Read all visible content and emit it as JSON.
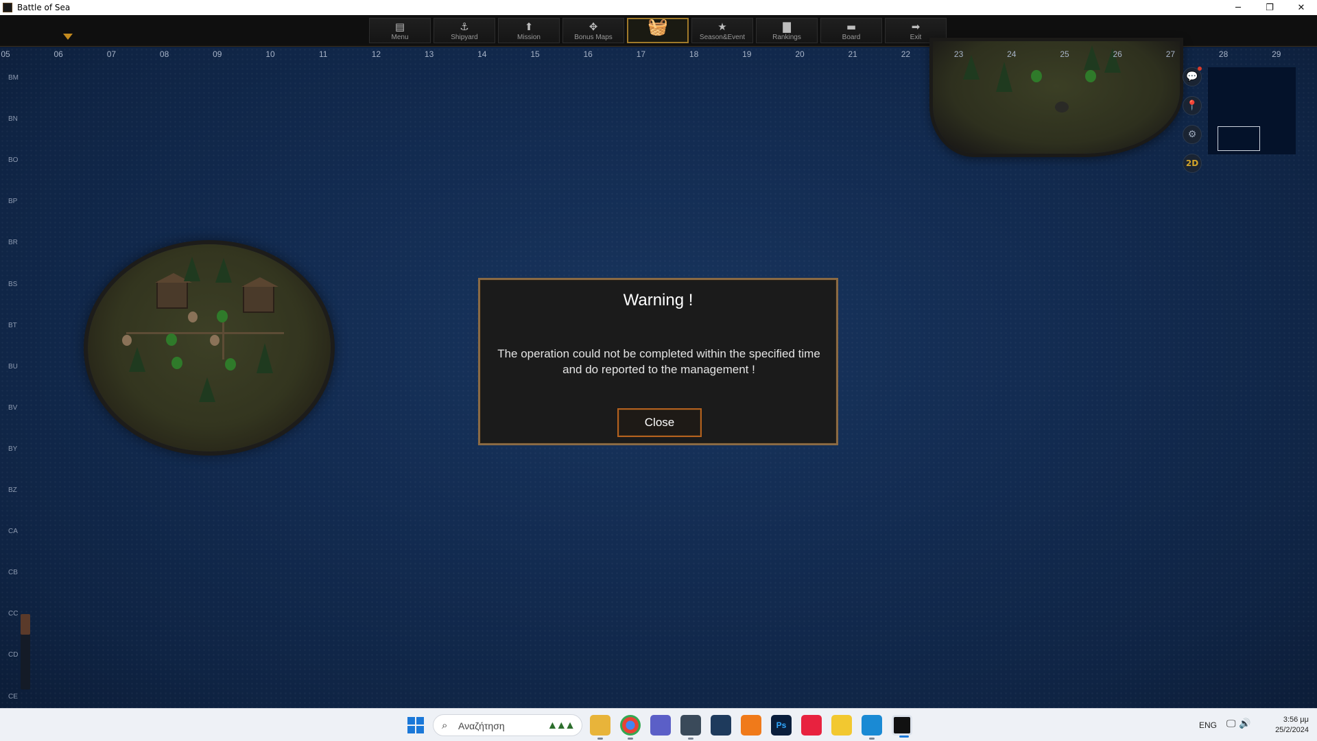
{
  "window": {
    "title": "Battle of Sea",
    "controls": {
      "minimize": "─",
      "restore": "❐",
      "close": "✕"
    }
  },
  "nav": {
    "items": [
      {
        "label": "Menu",
        "icon": "menu-icon",
        "glyph": "▤"
      },
      {
        "label": "Shipyard",
        "icon": "anchor-icon",
        "glyph": "⚓"
      },
      {
        "label": "Mission",
        "icon": "up-arrow-icon",
        "glyph": "⬆"
      },
      {
        "label": "Bonus Maps",
        "icon": "map-compass-icon",
        "glyph": "✥"
      },
      {
        "label": "",
        "icon": "shop-basket-icon",
        "glyph": "🧺"
      },
      {
        "label": "Season&Event",
        "icon": "star-icon",
        "glyph": "★"
      },
      {
        "label": "Rankings",
        "icon": "bar-chart-icon",
        "glyph": "▇"
      },
      {
        "label": "Board",
        "icon": "board-icon",
        "glyph": "▬"
      },
      {
        "label": "Exit",
        "icon": "exit-arrow-icon",
        "glyph": "➡"
      }
    ]
  },
  "grid": {
    "columns": [
      "05",
      "06",
      "07",
      "08",
      "09",
      "10",
      "11",
      "12",
      "13",
      "14",
      "15",
      "16",
      "17",
      "18",
      "19",
      "20",
      "21",
      "22",
      "23",
      "24",
      "25",
      "26",
      "27",
      "28",
      "29"
    ],
    "rows": [
      "BM",
      "BN",
      "BO",
      "BP",
      "BR",
      "BS",
      "BT",
      "BU",
      "BV",
      "BY",
      "BZ",
      "CA",
      "CB",
      "CC",
      "CD",
      "CE"
    ]
  },
  "side_controls": {
    "chat": "💬",
    "location": "📍",
    "settings": "⚙",
    "view_mode": "2D"
  },
  "dialog": {
    "title": "Warning !",
    "message": "The operation could not be completed within the specified time and do reported to the management !",
    "button": "Close"
  },
  "taskbar": {
    "search_placeholder": "Αναζήτηση",
    "language": "ENG",
    "time": "3:56 μμ",
    "date": "25/2/2024",
    "colors": {
      "accent": "#1b78d8"
    }
  }
}
